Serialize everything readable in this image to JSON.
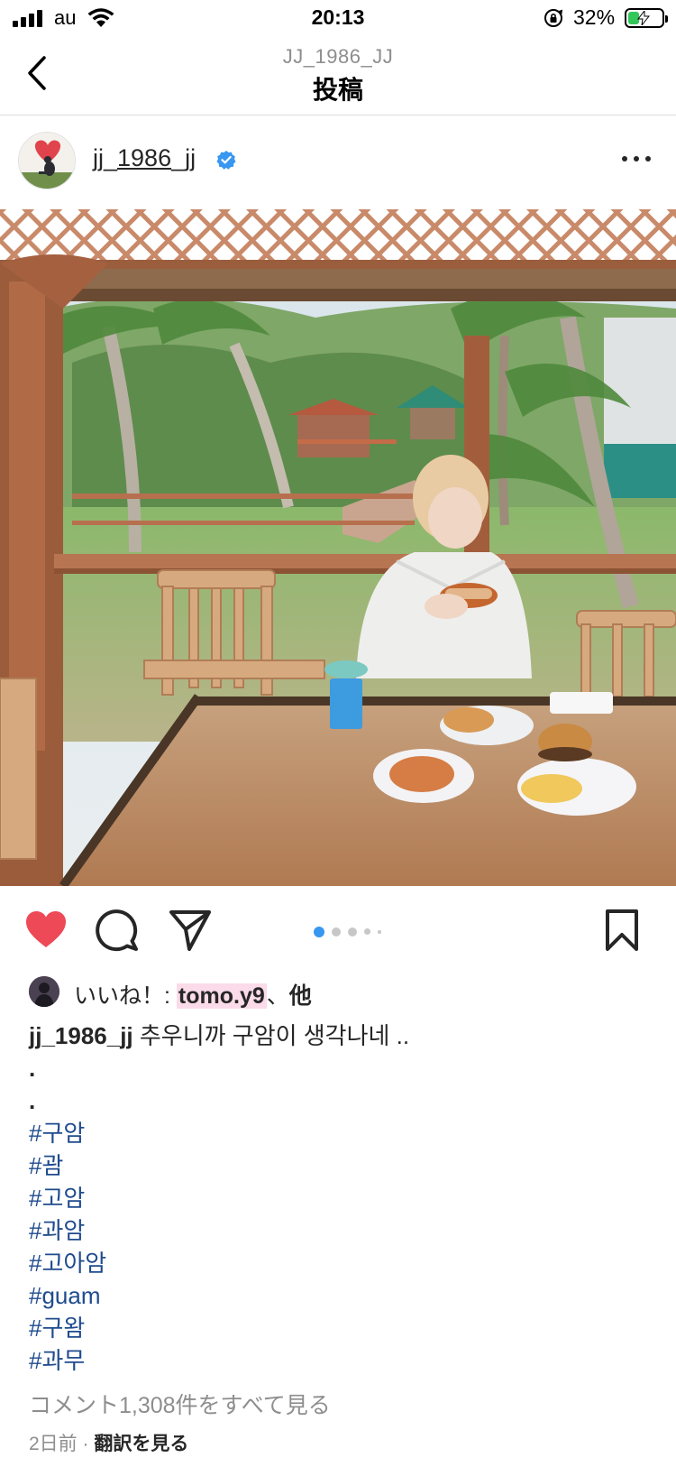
{
  "status_bar": {
    "carrier": "au",
    "time": "20:13",
    "battery_percent": "32%",
    "battery_level": 0.32,
    "battery_color": "#32c759"
  },
  "nav": {
    "account": "JJ_1986_JJ",
    "title": "投稿",
    "back_icon": "chevron-left-icon"
  },
  "post": {
    "username_prefix": "jj_",
    "username_underlined": "1986",
    "username_suffix": "_jj",
    "verified_color": "#3897f0",
    "photo_description_icon": "image"
  },
  "actions": {
    "like_color": "#ed4956",
    "liked": true,
    "carousel_total": 5,
    "carousel_active": 1,
    "carousel_active_color": "#3897f0"
  },
  "likes": {
    "prefix": "いいね！: ",
    "liker": "tomo.y9",
    "separator": "、",
    "others": "他"
  },
  "caption": {
    "username": "jj_1986_jj",
    "text": " 추우니까 구암이 생각나네 ..",
    "dot1": ".",
    "dot2": ".",
    "hashtags": [
      "#구암",
      "#괌",
      "#고암",
      "#과암",
      "#고아암",
      "#guam",
      "#구왐",
      "#과무"
    ],
    "hashtag_color": "#1f4b8e"
  },
  "footer": {
    "view_comments": "コメント1,308件をすべて見る",
    "time_ago": "2日前",
    "dot": " · ",
    "translate": "翻訳を見る"
  }
}
